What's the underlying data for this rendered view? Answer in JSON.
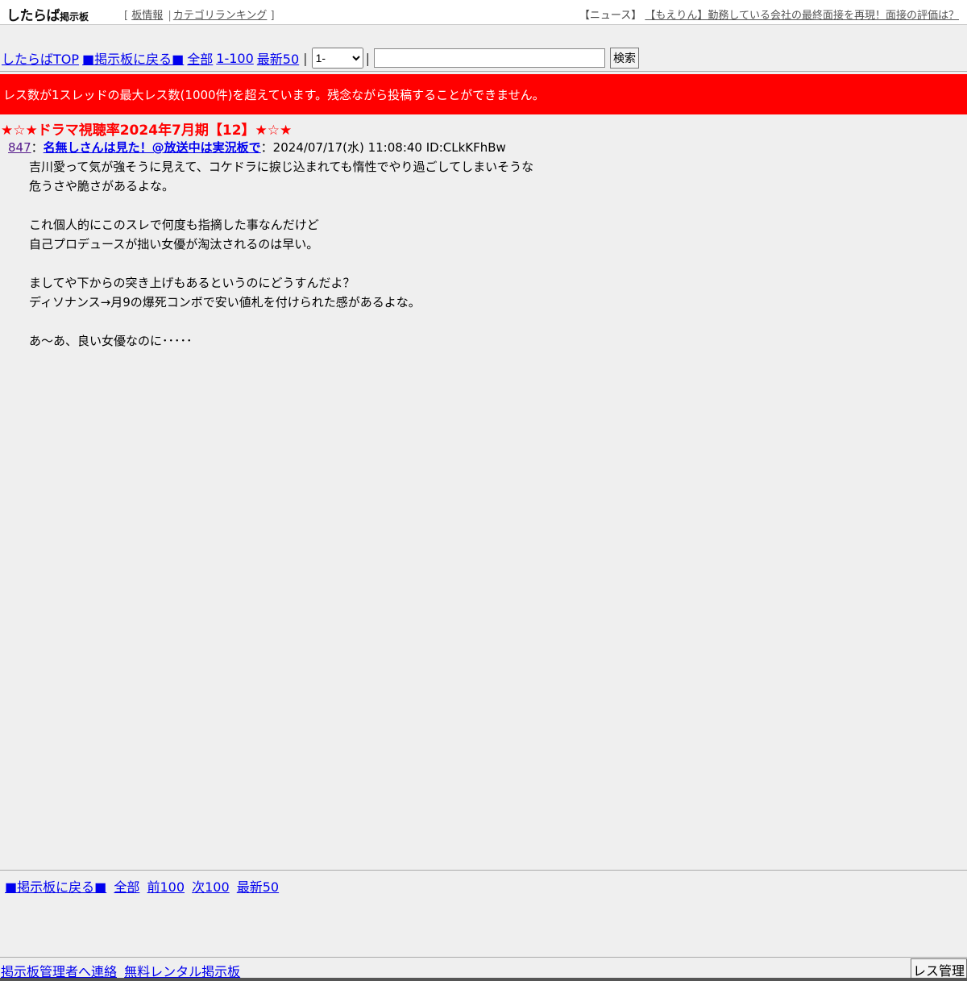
{
  "header": {
    "logo_main": "したらば",
    "logo_sub": "掲示板",
    "bracket_open": "[",
    "bracket_close": "]",
    "separator": "|",
    "board_info_label": "板情報",
    "category_ranking_label": "カテゴリランキング",
    "news_prefix": "【ニュース】",
    "news_link": "【もえりん】勤務している会社の最終面接を再現！面接の評価は？"
  },
  "nav": {
    "top_link": "したらばTOP",
    "back_link": "■掲示板に戻る■",
    "all_link": "全部",
    "range_link": "1-100",
    "latest_link": "最新50",
    "separator": "|",
    "range_select_value": "1-",
    "search_value": "",
    "search_button": "検索"
  },
  "alert": {
    "message": "レス数が1スレッドの最大レス数(1000件)を超えています。残念ながら投稿することができません。"
  },
  "thread": {
    "title": "★☆★ドラマ視聴率2024年7月期【12】★☆★"
  },
  "post": {
    "number": "847",
    "colon": "：",
    "name": "名無しさんは見た！@放送中は実況板で",
    "meta": "：2024/07/17(水) 11:08:40 ID:CLkKFhBw",
    "lines": [
      "吉川愛って気が強そうに見えて、コケドラに捩じ込まれても惰性でやり過ごしてしまいそうな",
      "危うさや脆さがあるよな。",
      "",
      "これ個人的にこのスレで何度も指摘した事なんだけど",
      "自己プロデュースが拙い女優が淘汰されるのは早い。",
      "",
      "ましてや下からの突き上げもあるというのにどうすんだよ？",
      "ディソナンス→月9の爆死コンボで安い値札を付けられた感があるよな。",
      "",
      "あ～あ、良い女優なのに･････"
    ]
  },
  "bottom_nav": {
    "back_link": "■掲示板に戻る■",
    "all_link": "全部",
    "prev_link": "前100",
    "next_link": "次100",
    "latest_link": "最新50"
  },
  "footer": {
    "contact_link": "掲示板管理者へ連絡",
    "rental_link": "無料レンタル掲示板",
    "res_manage_button": "レス管理"
  }
}
